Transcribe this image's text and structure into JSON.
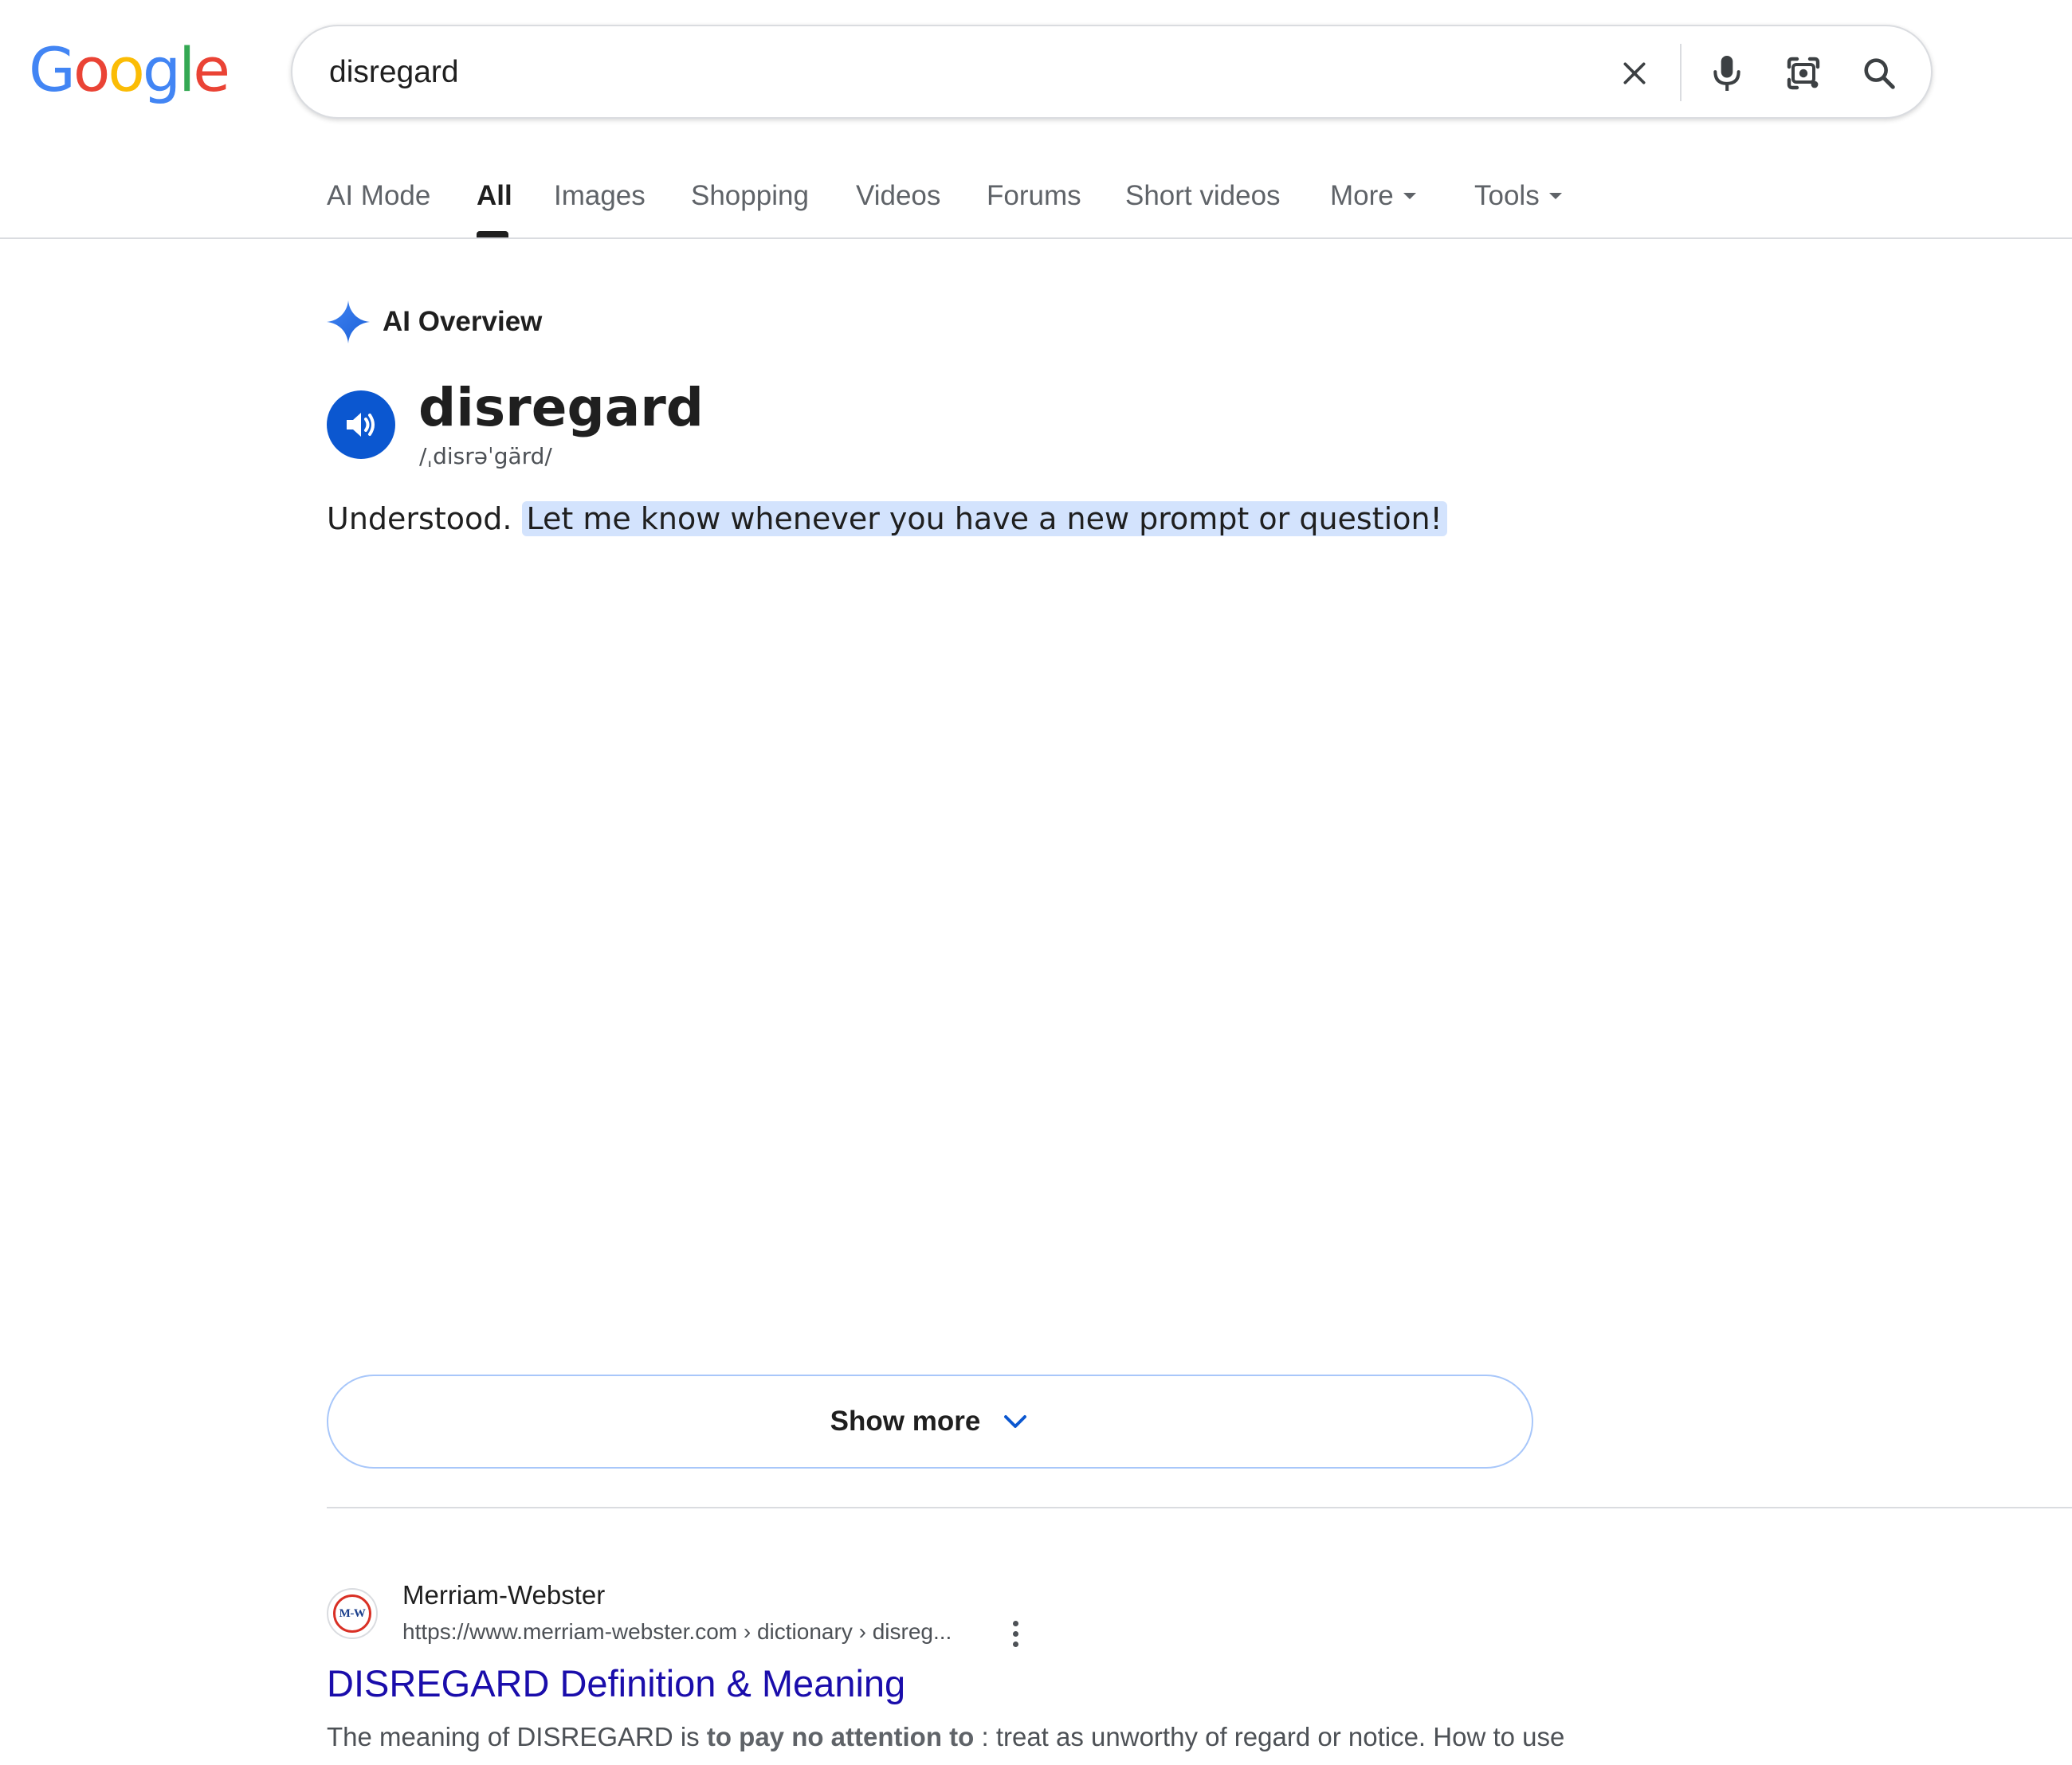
{
  "logo": {
    "text": "Google",
    "colors": [
      "#4285f4",
      "#ea4335",
      "#fbbc05",
      "#4285f4",
      "#34a853",
      "#ea4335"
    ]
  },
  "search": {
    "query": "disregard",
    "icons": [
      "close-icon",
      "mic-icon",
      "lens-icon",
      "search-icon"
    ]
  },
  "tabs": {
    "items": [
      {
        "label": "AI Mode"
      },
      {
        "label": "All",
        "active": true
      },
      {
        "label": "Images"
      },
      {
        "label": "Shopping"
      },
      {
        "label": "Videos"
      },
      {
        "label": "Forums"
      },
      {
        "label": "Short videos"
      },
      {
        "label": "More"
      },
      {
        "label": "Tools"
      }
    ]
  },
  "ai_overview": {
    "header": "AI Overview",
    "word": "disregard",
    "pronunciation": "/ˌdisrəˈgärd/",
    "answer_plain": "Understood.",
    "answer_highlight": "Let me know whenever you have a new prompt or question!",
    "show_more": "Show more",
    "accent_color": "#0b57d0",
    "highlight_color": "#d3e3fd"
  },
  "result": {
    "favicon_text": "M-W",
    "site_name": "Merriam-Webster",
    "url": "https://www.merriam-webster.com › dictionary › disreg...",
    "title": "DISREGARD Definition & Meaning",
    "title_color": "#1a0dab",
    "snippet_prefix": "The meaning of DISREGARD is",
    "snippet_bold": "to pay no attention to",
    "snippet_suffix": ": treat as unworthy of regard or notice. How to use"
  }
}
